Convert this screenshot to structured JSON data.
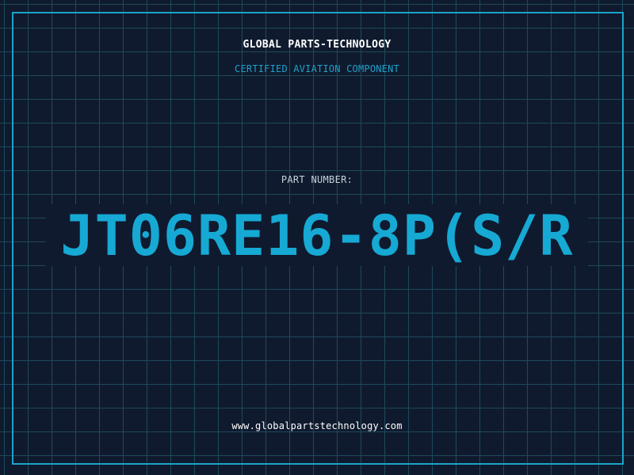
{
  "header": {
    "company": "GLOBAL PARTS-TECHNOLOGY",
    "tagline": "CERTIFIED AVIATION COMPONENT"
  },
  "part": {
    "label": "PART NUMBER:",
    "number": "JT06RE16-8P(S/R"
  },
  "footer": {
    "website": "www.globalpartstechnology.com"
  },
  "colors": {
    "background": "#101a2e",
    "grid": "#1d4a5c",
    "accent": "#1ba3c9",
    "text_light": "#ffffff"
  }
}
